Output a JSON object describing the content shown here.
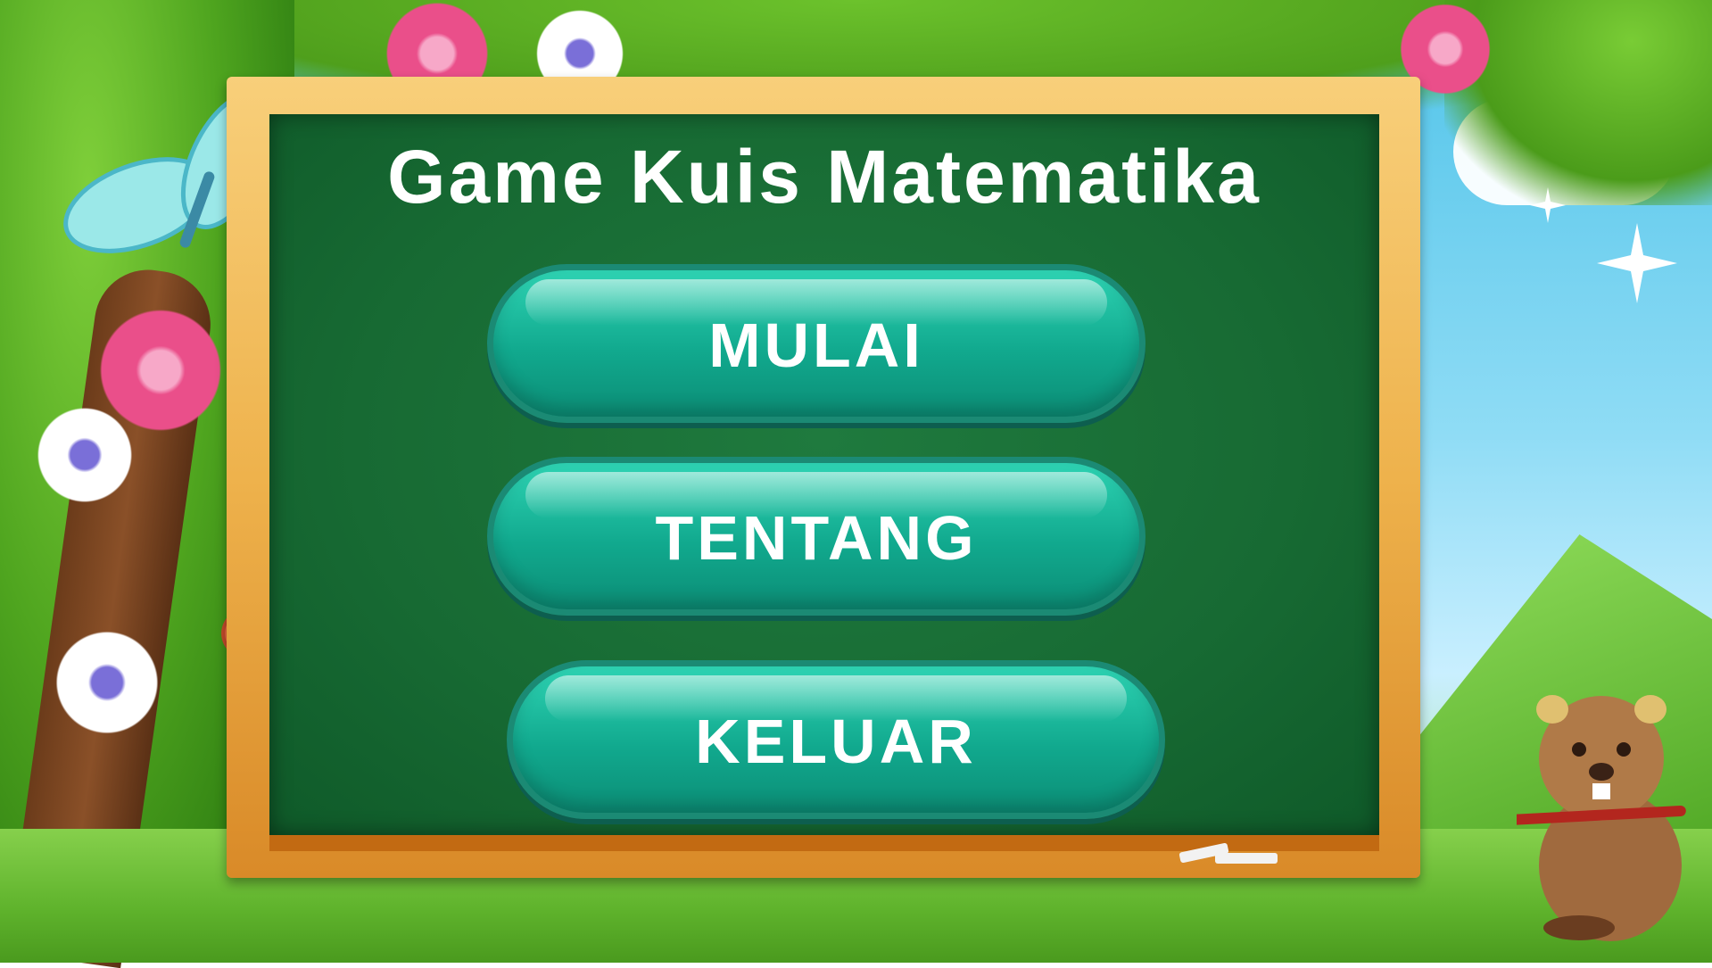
{
  "title": "Game Kuis Matematika",
  "menu": {
    "start_label": "MULAI",
    "about_label": "TENTANG",
    "exit_label": "KELUAR"
  },
  "colors": {
    "board": "#176a33",
    "frame": "#eeb24c",
    "button": "#11a98e",
    "text": "#ffffff"
  },
  "decor": {
    "icons": [
      "butterfly-icon",
      "flower-icon",
      "beaver-icon",
      "chalk-icon",
      "star-icon"
    ]
  }
}
